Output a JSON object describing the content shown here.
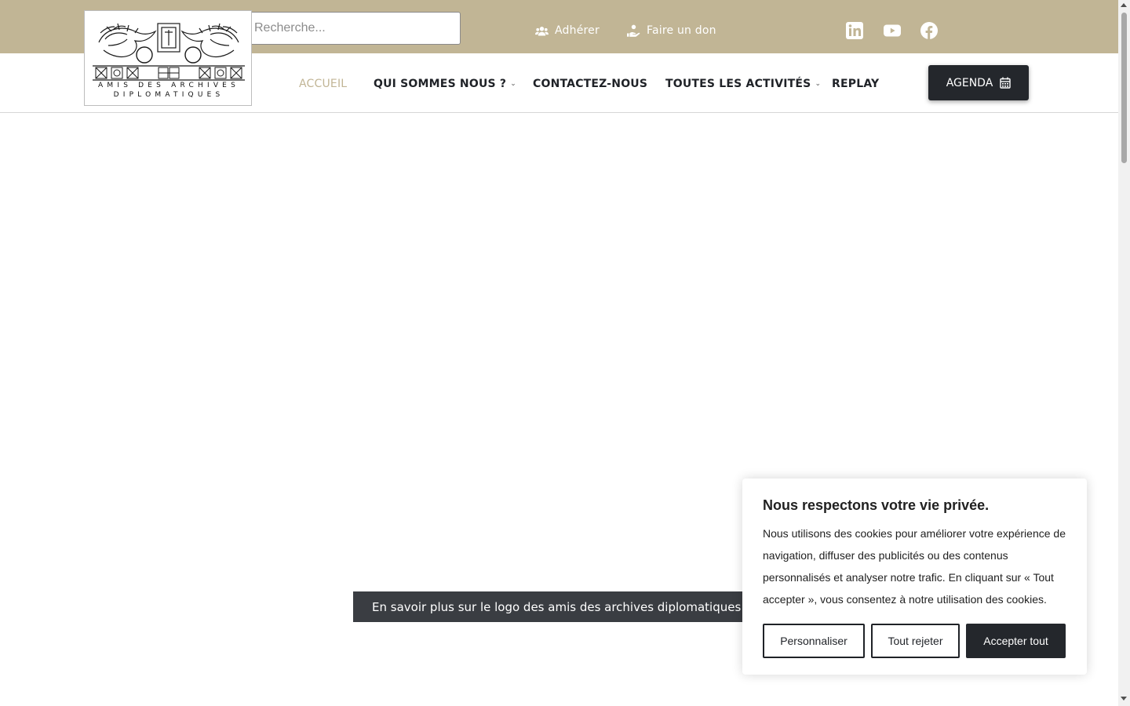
{
  "header": {
    "search_placeholder": "Recherche...",
    "links": [
      {
        "label": "Adhérer",
        "icon": "users-icon"
      },
      {
        "label": "Faire un don",
        "icon": "donate-hand-icon"
      }
    ],
    "social": [
      "linkedin-icon",
      "youtube-icon",
      "facebook-icon"
    ],
    "accent_color": "#c1b595"
  },
  "logo": {
    "line1": "AMIS DES ARCHIVES",
    "line2": "DIPLOMATIQUES"
  },
  "nav": {
    "items": [
      {
        "label": "ACCUEIL",
        "active": true
      },
      {
        "label": "QUI SOMMES NOUS ?",
        "has_dropdown": true
      },
      {
        "label": "CONTACTEZ-NOUS"
      },
      {
        "label": "TOUTES LES ACTIVITÉS",
        "has_dropdown": true
      },
      {
        "label": "REPLAY"
      }
    ],
    "agenda_label": "AGENDA",
    "agenda_icon": "calendar-icon"
  },
  "main": {
    "learn_more_label": "En savoir plus sur le logo des amis des archives diplomatiques",
    "learn_more_icon": "arrow-right-icon"
  },
  "cookie": {
    "title": "Nous respectons votre vie privée.",
    "text": "Nous utilisons des cookies pour améliorer votre expérience de navigation, diffuser des publicités ou des contenus personnalisés et analyser notre trafic. En cliquant sur « Tout accepter », vous consentez à notre utilisation des cookies.",
    "customize_label": "Personnaliser",
    "reject_label": "Tout rejeter",
    "accept_label": "Accepter tout"
  }
}
